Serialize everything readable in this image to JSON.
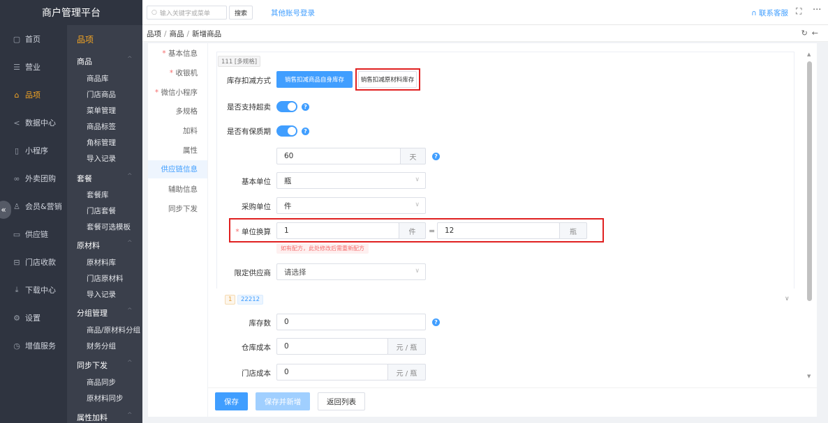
{
  "app": {
    "title": "商户管理平台"
  },
  "sidebar": {
    "items": [
      {
        "label": "首页",
        "icon": "file-icon"
      },
      {
        "label": "营业",
        "icon": "list-icon"
      },
      {
        "label": "品项",
        "icon": "bag-icon"
      },
      {
        "label": "数据中心",
        "icon": "share-icon"
      },
      {
        "label": "小程序",
        "icon": "phone-icon"
      },
      {
        "label": "外卖团购",
        "icon": "bike-icon"
      },
      {
        "label": "会员&营销",
        "icon": "user-icon"
      },
      {
        "label": "供应链",
        "icon": "truck-icon"
      },
      {
        "label": "门店收款",
        "icon": "wallet-icon"
      },
      {
        "label": "下载中心",
        "icon": "download-icon"
      },
      {
        "label": "设置",
        "icon": "gear-icon"
      },
      {
        "label": "增值服务",
        "icon": "clock-icon"
      }
    ],
    "collapse_icon": "«"
  },
  "subnav": {
    "title": "品项",
    "groups": [
      {
        "label": "商品",
        "items": [
          "商品库",
          "门店商品",
          "菜单管理",
          "商品标签",
          "角标管理",
          "导入记录"
        ]
      },
      {
        "label": "套餐",
        "items": [
          "套餐库",
          "门店套餐",
          "套餐可选模板"
        ]
      },
      {
        "label": "原材料",
        "items": [
          "原材料库",
          "门店原材料",
          "导入记录"
        ]
      },
      {
        "label": "分组管理",
        "items": [
          "商品/原材料分组",
          "财务分组"
        ]
      },
      {
        "label": "同步下发",
        "items": [
          "商品同步",
          "原材料同步"
        ]
      },
      {
        "label": "属性加料",
        "items": []
      }
    ]
  },
  "topbar": {
    "search_placeholder": "输入关键字或菜单",
    "search_button": "搜索",
    "other_login": "其他账号登录",
    "contact": "联系客服"
  },
  "breadcrumb": [
    "品项",
    "商品",
    "新增商品"
  ],
  "form_nav": [
    {
      "label": "基本信息",
      "required": true
    },
    {
      "label": "收银机",
      "required": true
    },
    {
      "label": "微信小程序",
      "required": true
    },
    {
      "label": "多规格",
      "required": false
    },
    {
      "label": "加料",
      "required": false
    },
    {
      "label": "属性",
      "required": false
    },
    {
      "label": "供应链信息",
      "required": false,
      "active": true
    },
    {
      "label": "辅助信息",
      "required": false
    },
    {
      "label": "同步下发",
      "required": false
    }
  ],
  "form": {
    "spec_tag": "111 [多规格]",
    "deduct_label": "库存扣减方式",
    "deduct_options": [
      "销售扣减商品自身库存",
      "销售扣减原材料库存"
    ],
    "combo_label": "是否支持超卖",
    "shelf_label": "是否有保质期",
    "shelf_value": "60",
    "shelf_unit": "天",
    "base_unit_label": "基本单位",
    "base_unit_value": "瓶",
    "purchase_unit_label": "采购单位",
    "purchase_unit_value": "件",
    "conversion_label": "单位换算",
    "conversion_left": "1",
    "conversion_left_unit": "件",
    "conversion_eq": "=",
    "conversion_right": "12",
    "conversion_right_unit": "瓶",
    "conversion_tip": "如有配方，此处修改后需重新配方",
    "supplier_label": "限定供应商",
    "supplier_placeholder": "请选择",
    "batch_index": "1",
    "batch_name": "22212",
    "stock_label": "库存数",
    "stock_value": "0",
    "wh_cost_label": "仓库成本",
    "wh_cost_value": "0",
    "wh_cost_unit": "元 / 瓶",
    "store_cost_label": "门店成本",
    "store_cost_value": "0",
    "store_cost_unit": "元 / 瓶"
  },
  "footer": {
    "save": "保存",
    "save_add": "保存并新增",
    "back": "返回列表"
  }
}
